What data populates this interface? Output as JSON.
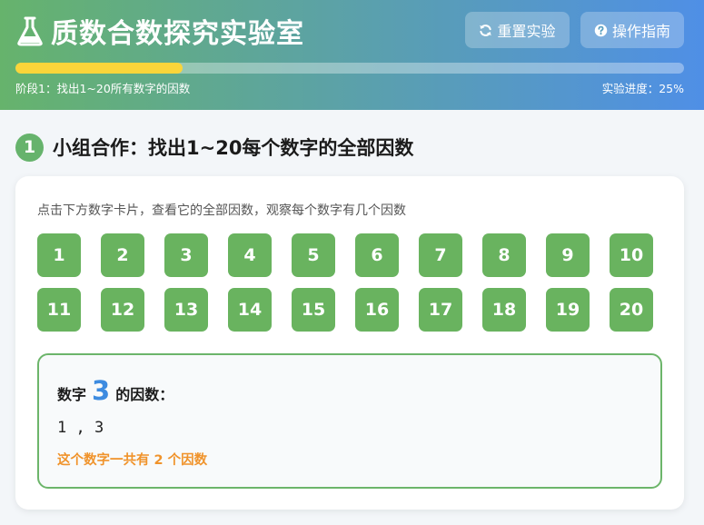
{
  "header": {
    "title": "质数合数探究实验室",
    "title_icon": "flask-icon",
    "buttons": {
      "reset_label": "重置实验",
      "reset_icon": "refresh-icon",
      "guide_label": "操作指南",
      "guide_icon": "question-circle-icon"
    },
    "stage": "阶段1：找出1~20所有数字的因数",
    "progress_label": "实验进度：25%",
    "progress_percent": 25
  },
  "section": {
    "step": "1",
    "title": "小组合作：找出1~20每个数字的全部因数"
  },
  "card": {
    "instructions": "点击下方数字卡片，查看它的全部因数，观察每个数字有几个因数",
    "numbers": [
      "1",
      "2",
      "3",
      "4",
      "5",
      "6",
      "7",
      "8",
      "9",
      "10",
      "11",
      "12",
      "13",
      "14",
      "15",
      "16",
      "17",
      "18",
      "19",
      "20"
    ],
    "result": {
      "prefix": "数字",
      "number": "3",
      "suffix": "的因数：",
      "factors": "1 , 3",
      "count_text": "这个数字一共有 2 个因数"
    }
  },
  "colors": {
    "brand_green": "#66b36c",
    "brand_blue": "#4f8fe6",
    "progress_yellow": "#fad53a",
    "card_green": "#69b35f",
    "highlight_blue": "#3d8be0",
    "count_orange": "#f0932b"
  }
}
